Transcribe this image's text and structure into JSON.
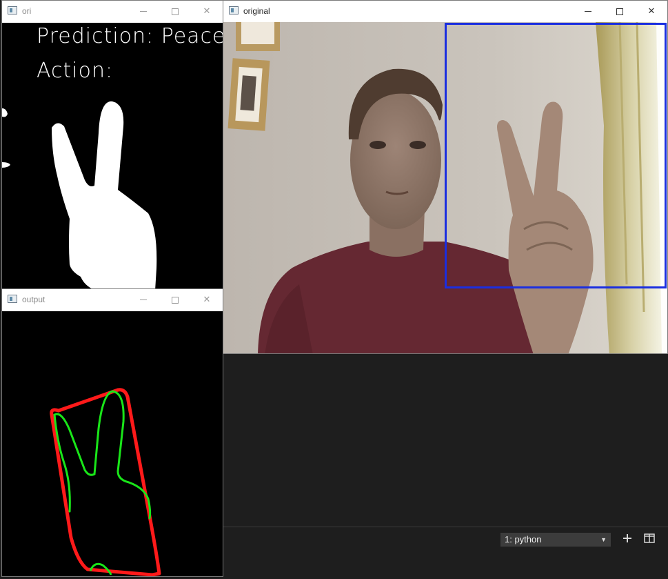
{
  "windows": {
    "ori": {
      "title": "ori",
      "prediction_label": "Prediction:",
      "prediction_value": "Peace",
      "action_label": "Action:"
    },
    "output": {
      "title": "output"
    },
    "original": {
      "title": "original"
    }
  },
  "terminal": {
    "shell_select": "1: python",
    "add_icon": "plus-icon",
    "split_icon": "split-icon"
  },
  "colors": {
    "bbox": "#1a2ee0",
    "hull": "#ff1a1a",
    "contour": "#19e619",
    "shirt": "#6a2a30",
    "wall": "#c6c0b8"
  }
}
